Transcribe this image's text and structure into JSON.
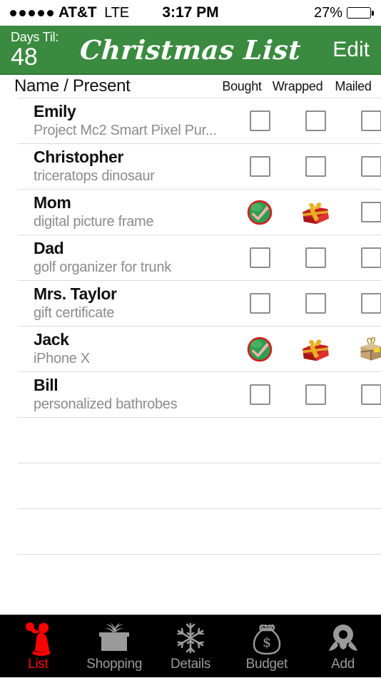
{
  "status_bar": {
    "signal_dots": 5,
    "carrier": "AT&T",
    "network": "LTE",
    "time": "3:17 PM",
    "battery_percent": "27%",
    "battery_level": 27
  },
  "nav": {
    "days_label": "Days Til:",
    "days_value": "48",
    "app_title": "Christmas List",
    "edit_label": "Edit",
    "accent_green": "#3a8a3f"
  },
  "column_headers": {
    "name_present": "Name / Present",
    "bought": "Bought",
    "wrapped": "Wrapped",
    "mailed": "Mailed"
  },
  "list": {
    "rows": [
      {
        "name": "Emily",
        "present": "Project Mc2 Smart Pixel Pur...",
        "bought": false,
        "wrapped": false,
        "mailed": false
      },
      {
        "name": "Christopher",
        "present": "triceratops dinosaur",
        "bought": false,
        "wrapped": false,
        "mailed": false
      },
      {
        "name": "Mom",
        "present": "digital picture frame",
        "bought": true,
        "wrapped": true,
        "mailed": false
      },
      {
        "name": "Dad",
        "present": "golf organizer for trunk",
        "bought": false,
        "wrapped": false,
        "mailed": false
      },
      {
        "name": "Mrs. Taylor",
        "present": "gift certificate",
        "bought": false,
        "wrapped": false,
        "mailed": false
      },
      {
        "name": "Jack",
        "present": "iPhone X",
        "bought": true,
        "wrapped": true,
        "mailed": true
      },
      {
        "name": "Bill",
        "present": "personalized bathrobes",
        "bought": false,
        "wrapped": false,
        "mailed": false
      }
    ],
    "empty_row_count": 4,
    "icons": {
      "bought_checked": "green-check-circle-icon",
      "wrapped_checked": "red-gift-box-icon",
      "mailed_checked": "brown-parcel-icon",
      "unchecked": "empty-checkbox-icon"
    }
  },
  "tabbar": {
    "background": "#000000",
    "active_color": "#ff0000",
    "inactive_color": "#9a9a9a",
    "tabs": [
      {
        "label": "List",
        "icon": "santa-icon",
        "active": true
      },
      {
        "label": "Shopping",
        "icon": "gift-icon",
        "active": false
      },
      {
        "label": "Details",
        "icon": "snowflake-icon",
        "active": false
      },
      {
        "label": "Budget",
        "icon": "money-bag-icon",
        "active": false
      },
      {
        "label": "Add",
        "icon": "wreath-icon",
        "active": false
      }
    ]
  }
}
